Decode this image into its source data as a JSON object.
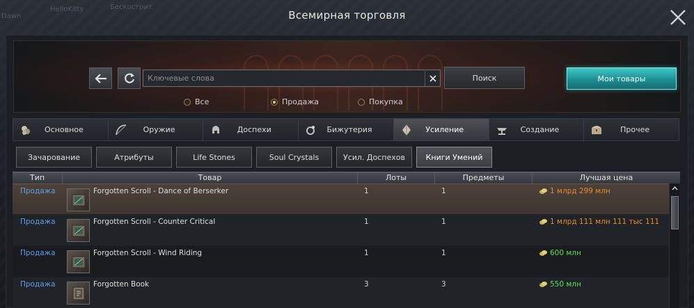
{
  "window": {
    "title": "Всемирная торговля"
  },
  "background_names": [
    "Dawn",
    "HelloKitty",
    "Бескострит"
  ],
  "search": {
    "placeholder": "Ключевые слова",
    "button": "Поиск",
    "my_goods": "Мои товары"
  },
  "filters": [
    {
      "label": "Все",
      "selected": false
    },
    {
      "label": "Продажа",
      "selected": true
    },
    {
      "label": "Покупка",
      "selected": false
    }
  ],
  "categories": [
    {
      "label": "Основное",
      "icon": "coins-icon",
      "active": false
    },
    {
      "label": "Оружие",
      "icon": "bow-icon",
      "active": false
    },
    {
      "label": "Доспехи",
      "icon": "helmet-icon",
      "active": false
    },
    {
      "label": "Бижутерия",
      "icon": "ring-icon",
      "active": false
    },
    {
      "label": "Усиление",
      "icon": "crystal-icon",
      "active": true
    },
    {
      "label": "Создание",
      "icon": "anvil-icon",
      "active": false
    },
    {
      "label": "Прочее",
      "icon": "chest-icon",
      "active": false
    }
  ],
  "subcategories": [
    {
      "label": "Зачарование",
      "active": false
    },
    {
      "label": "Атрибуты",
      "active": false
    },
    {
      "label": "Life Stones",
      "active": false
    },
    {
      "label": "Soul Crystals",
      "active": false
    },
    {
      "label": "Усил. Доспехов",
      "active": false
    },
    {
      "label": "Книги Умений",
      "active": true
    }
  ],
  "table": {
    "headers": {
      "type": "Тип",
      "item": "Товар",
      "lots": "Лоты",
      "qty": "Предметы",
      "price": "Лучшая цена"
    },
    "rows": [
      {
        "type": "Продажа",
        "name": "Forgotten Scroll - Dance of Berserker",
        "lots": "1",
        "qty": "1",
        "price": "1 млрд 299 млн",
        "price_color": "orange",
        "icon": "scroll-icon"
      },
      {
        "type": "Продажа",
        "name": "Forgotten Scroll - Counter Critical",
        "lots": "1",
        "qty": "1",
        "price": "1 млрд 111 млн 111 тыс 111",
        "price_color": "orange",
        "icon": "scroll-icon"
      },
      {
        "type": "Продажа",
        "name": "Forgotten Scroll - Wind Riding",
        "lots": "1",
        "qty": "1",
        "price": "600 млн",
        "price_color": "green",
        "icon": "scroll-icon"
      },
      {
        "type": "Продажа",
        "name": "Forgotten Book",
        "lots": "3",
        "qty": "3",
        "price": "550 млн",
        "price_color": "green",
        "icon": "book-icon"
      }
    ]
  }
}
